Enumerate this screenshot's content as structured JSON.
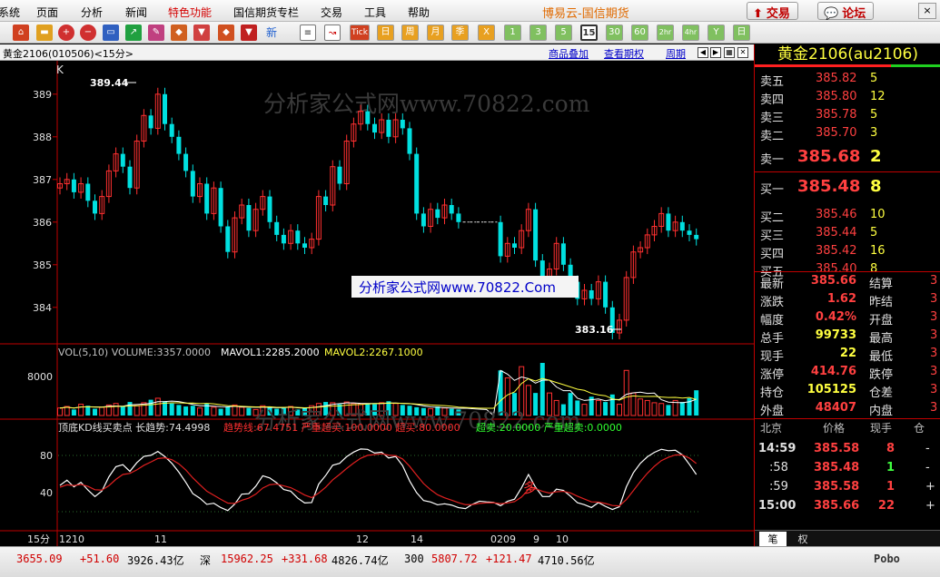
{
  "menu": {
    "items": [
      "系统",
      "页面",
      "分析",
      "新闻",
      "特色功能",
      "国信期货专栏",
      "交易",
      "工具",
      "帮助"
    ],
    "highlight_index": 4,
    "brand": "博易云-国信期货",
    "trade_btn": "交易",
    "forum_btn": "论坛",
    "close_btn": "×"
  },
  "toolbar": {
    "icons": [
      "home-icon",
      "folder-icon",
      "zoom-in-icon",
      "zoom-out-icon",
      "monitor-icon",
      "chart-icon",
      "pencil-icon",
      "paint-icon",
      "funnel-icon"
    ],
    "news_label": "新",
    "text_buttons": [
      "Tick",
      "日",
      "周",
      "月",
      "季",
      "X",
      "1",
      "3",
      "5",
      "15",
      "30",
      "60",
      "2hr",
      "4hr",
      "Y",
      "日"
    ],
    "selected": "15"
  },
  "chart_header": {
    "title": "黄金2106(010506)<15分>",
    "link_overlay": "商品叠加",
    "link_view": "查看期权",
    "link_period": "周期"
  },
  "watermarks": {
    "top": "分析家公式网www.70822.com",
    "center": "分析家公式网www.70822.Com",
    "bottom": "分析家公式网www.70822.com"
  },
  "price_pane": {
    "label": "K",
    "high_label": "389.44",
    "low_label": "383.16",
    "y_ticks": [
      {
        "v": 389,
        "t": "389"
      },
      {
        "v": 388,
        "t": "388"
      },
      {
        "v": 387,
        "t": "387"
      },
      {
        "v": 386,
        "t": "386"
      },
      {
        "v": 385,
        "t": "385"
      },
      {
        "v": 384,
        "t": "384"
      }
    ]
  },
  "vol_pane": {
    "label": "VOL(5,10) VOLUME:3357.0000",
    "mavol1": "MAVOL1:2285.2000",
    "mavol2": "MAVOL2:2267.1000",
    "y_tick": "8000"
  },
  "kd_pane": {
    "label": "顶底KD线买卖点 长趋势:74.4998",
    "seg_red": "趋势线:67.4751 严重超买:100.0000 超买:80.0000",
    "seg_green": "超卖:20.0000 严重超卖:0.0000",
    "signal": "多",
    "y_ticks": [
      "80",
      "40"
    ]
  },
  "x_axis": {
    "period": "15分",
    "ticks": [
      "1210",
      "11",
      "12",
      "14",
      "0209",
      "9",
      "10"
    ]
  },
  "sidebar": {
    "title": "黄金2106(au2106)",
    "asks": [
      {
        "label": "卖五",
        "price": "385.82",
        "vol": "5"
      },
      {
        "label": "卖四",
        "price": "385.80",
        "vol": "12"
      },
      {
        "label": "卖三",
        "price": "385.78",
        "vol": "5"
      },
      {
        "label": "卖二",
        "price": "385.70",
        "vol": "3"
      },
      {
        "label": "卖一",
        "price": "385.68",
        "vol": "2"
      }
    ],
    "bids": [
      {
        "label": "买一",
        "price": "385.48",
        "vol": "8"
      },
      {
        "label": "买二",
        "price": "385.46",
        "vol": "10"
      },
      {
        "label": "买三",
        "price": "385.44",
        "vol": "5"
      },
      {
        "label": "买四",
        "price": "385.42",
        "vol": "16"
      },
      {
        "label": "买五",
        "price": "385.40",
        "vol": "8"
      }
    ],
    "stats": [
      {
        "l1": "最新",
        "v": "385.66",
        "c": "#ff4040",
        "l2": "结算"
      },
      {
        "l1": "涨跌",
        "v": "1.62",
        "c": "#ff4040",
        "l2": "昨结"
      },
      {
        "l1": "幅度",
        "v": "0.42%",
        "c": "#ff4040",
        "l2": "开盘"
      },
      {
        "l1": "总手",
        "v": "99733",
        "c": "#ffff40",
        "l2": "最高"
      },
      {
        "l1": "现手",
        "v": "22",
        "c": "#ffff40",
        "l2": "最低"
      },
      {
        "l1": "涨停",
        "v": "414.76",
        "c": "#ff4040",
        "l2": "跌停"
      },
      {
        "l1": "持仓",
        "v": "105125",
        "c": "#ffff40",
        "l2": "仓差"
      },
      {
        "l1": "外盘",
        "v": "48407",
        "c": "#ff4040",
        "l2": "内盘"
      }
    ],
    "ticks_header": [
      "北京",
      "价格",
      "现手",
      "仓"
    ],
    "ticks": [
      {
        "t": "14:59",
        "p": "385.58",
        "v": "8",
        "f": "-",
        "vc": "#ff4040"
      },
      {
        "t": ":58",
        "p": "385.48",
        "v": "1",
        "f": "-",
        "vc": "#40ff40"
      },
      {
        "t": ":59",
        "p": "385.58",
        "v": "1",
        "f": "+",
        "vc": "#ff4040"
      },
      {
        "t": "15:00",
        "p": "385.66",
        "v": "22",
        "f": "+",
        "vc": "#ff4040"
      }
    ],
    "tabs": [
      "笔",
      "权"
    ]
  },
  "statusbar": {
    "items": [
      {
        "t": "3655.09",
        "c": "#d00000"
      },
      {
        "t": "+51.60",
        "c": "#d00000"
      },
      {
        "t": "3926.43亿",
        "c": "#000"
      },
      {
        "t": "深",
        "c": "#000"
      },
      {
        "t": "15962.25",
        "c": "#d00000"
      },
      {
        "t": "+331.68",
        "c": "#d00000"
      },
      {
        "t": "4826.74亿",
        "c": "#000"
      },
      {
        "t": "300",
        "c": "#000"
      },
      {
        "t": "5807.72",
        "c": "#d00000"
      },
      {
        "t": "+121.47",
        "c": "#d00000"
      },
      {
        "t": "4710.56亿",
        "c": "#000"
      }
    ],
    "right": "Pobo"
  },
  "chart_data": {
    "type": "candlestick",
    "title": "黄金2106(010506)<15分>",
    "ylim": [
      383.4,
      389.4
    ],
    "closes": [
      386.9,
      387.0,
      386.7,
      386.9,
      386.5,
      386.2,
      386.6,
      387.2,
      387.6,
      387.3,
      386.8,
      387.9,
      388.5,
      388.2,
      389.0,
      388.3,
      388.0,
      387.6,
      387.2,
      386.6,
      386.9,
      386.2,
      386.8,
      385.9,
      385.3,
      386.1,
      386.4,
      385.8,
      386.3,
      386.6,
      386.0,
      385.7,
      385.5,
      385.8,
      385.5,
      385.4,
      385.6,
      386.6,
      386.4,
      387.3,
      386.9,
      387.9,
      388.3,
      388.6,
      388.3,
      388.1,
      388.4,
      388.0,
      388.4,
      388.2,
      387.6,
      386.2,
      385.9,
      386.3,
      386.1,
      386.4,
      386.2,
      386.0,
      386.0,
      386.0,
      386.0,
      386.0,
      386.0,
      385.2,
      385.5,
      385.4,
      385.8,
      386.3,
      385.1,
      384.4,
      384.9,
      385.5,
      385.0,
      384.6,
      384.2,
      384.4,
      384.2,
      384.6,
      384.0,
      383.4,
      383.7,
      384.7,
      385.3,
      385.4,
      385.7,
      385.9,
      386.2,
      385.8,
      386.0,
      385.8,
      385.7,
      385.6
    ],
    "volumes": [
      1000,
      1200,
      800,
      1500,
      1300,
      900,
      1100,
      1400,
      1600,
      1200,
      1800,
      1300,
      1700,
      2100,
      2300,
      1900,
      1600,
      1400,
      1200,
      1300,
      1000,
      1600,
      1100,
      900,
      1200,
      1400,
      1100,
      1000,
      800,
      1300,
      1200,
      900,
      1000,
      1200,
      800,
      1000,
      1300,
      1600,
      1800,
      1700,
      1500,
      1800,
      1600,
      1500,
      1600,
      1500,
      1700,
      1900,
      1600,
      1400,
      1300,
      1100,
      1000,
      900,
      1200,
      1000,
      900,
      800,
      0,
      0,
      0,
      0,
      0,
      6000,
      5000,
      3000,
      6500,
      4000,
      3000,
      7000,
      3000,
      2000,
      1500,
      3000,
      2000,
      1500,
      2500,
      2000,
      1800,
      2800,
      1500,
      6000,
      3000,
      2200,
      2000,
      1700,
      1600,
      1400,
      2000,
      1800,
      2300,
      3357
    ]
  }
}
